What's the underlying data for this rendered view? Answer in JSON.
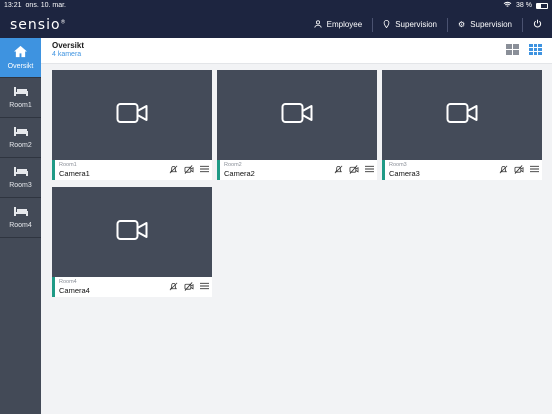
{
  "status": {
    "time": "13:21",
    "date": "ons. 10. mar.",
    "battery": "38 %",
    "battery_level": 0.38
  },
  "app": {
    "logo": "sensio"
  },
  "nav": [
    {
      "label": "Employee",
      "icon": "person-icon"
    },
    {
      "label": "Supervision",
      "icon": "location-icon"
    },
    {
      "label": "Supervision",
      "icon": "gear-icon"
    }
  ],
  "sidebar": {
    "items": [
      {
        "label": "Oversikt",
        "icon": "home-icon",
        "active": true
      },
      {
        "label": "Room1",
        "icon": "bed-icon"
      },
      {
        "label": "Room2",
        "icon": "bed-icon"
      },
      {
        "label": "Room3",
        "icon": "bed-icon"
      },
      {
        "label": "Room4",
        "icon": "bed-icon"
      }
    ]
  },
  "header": {
    "title": "Oversikt",
    "subtitle": "4 kamera"
  },
  "cameras": [
    {
      "room": "Room1",
      "name": "Camera1"
    },
    {
      "room": "Room2",
      "name": "Camera2"
    },
    {
      "room": "Room3",
      "name": "Camera3"
    },
    {
      "room": "Room4",
      "name": "Camera4"
    }
  ],
  "colors": {
    "accent": "#3e93e0",
    "topbar": "#1d2540",
    "sidebar": "#434a57",
    "video": "#444b59",
    "room_indicator": "#1f9a86"
  }
}
